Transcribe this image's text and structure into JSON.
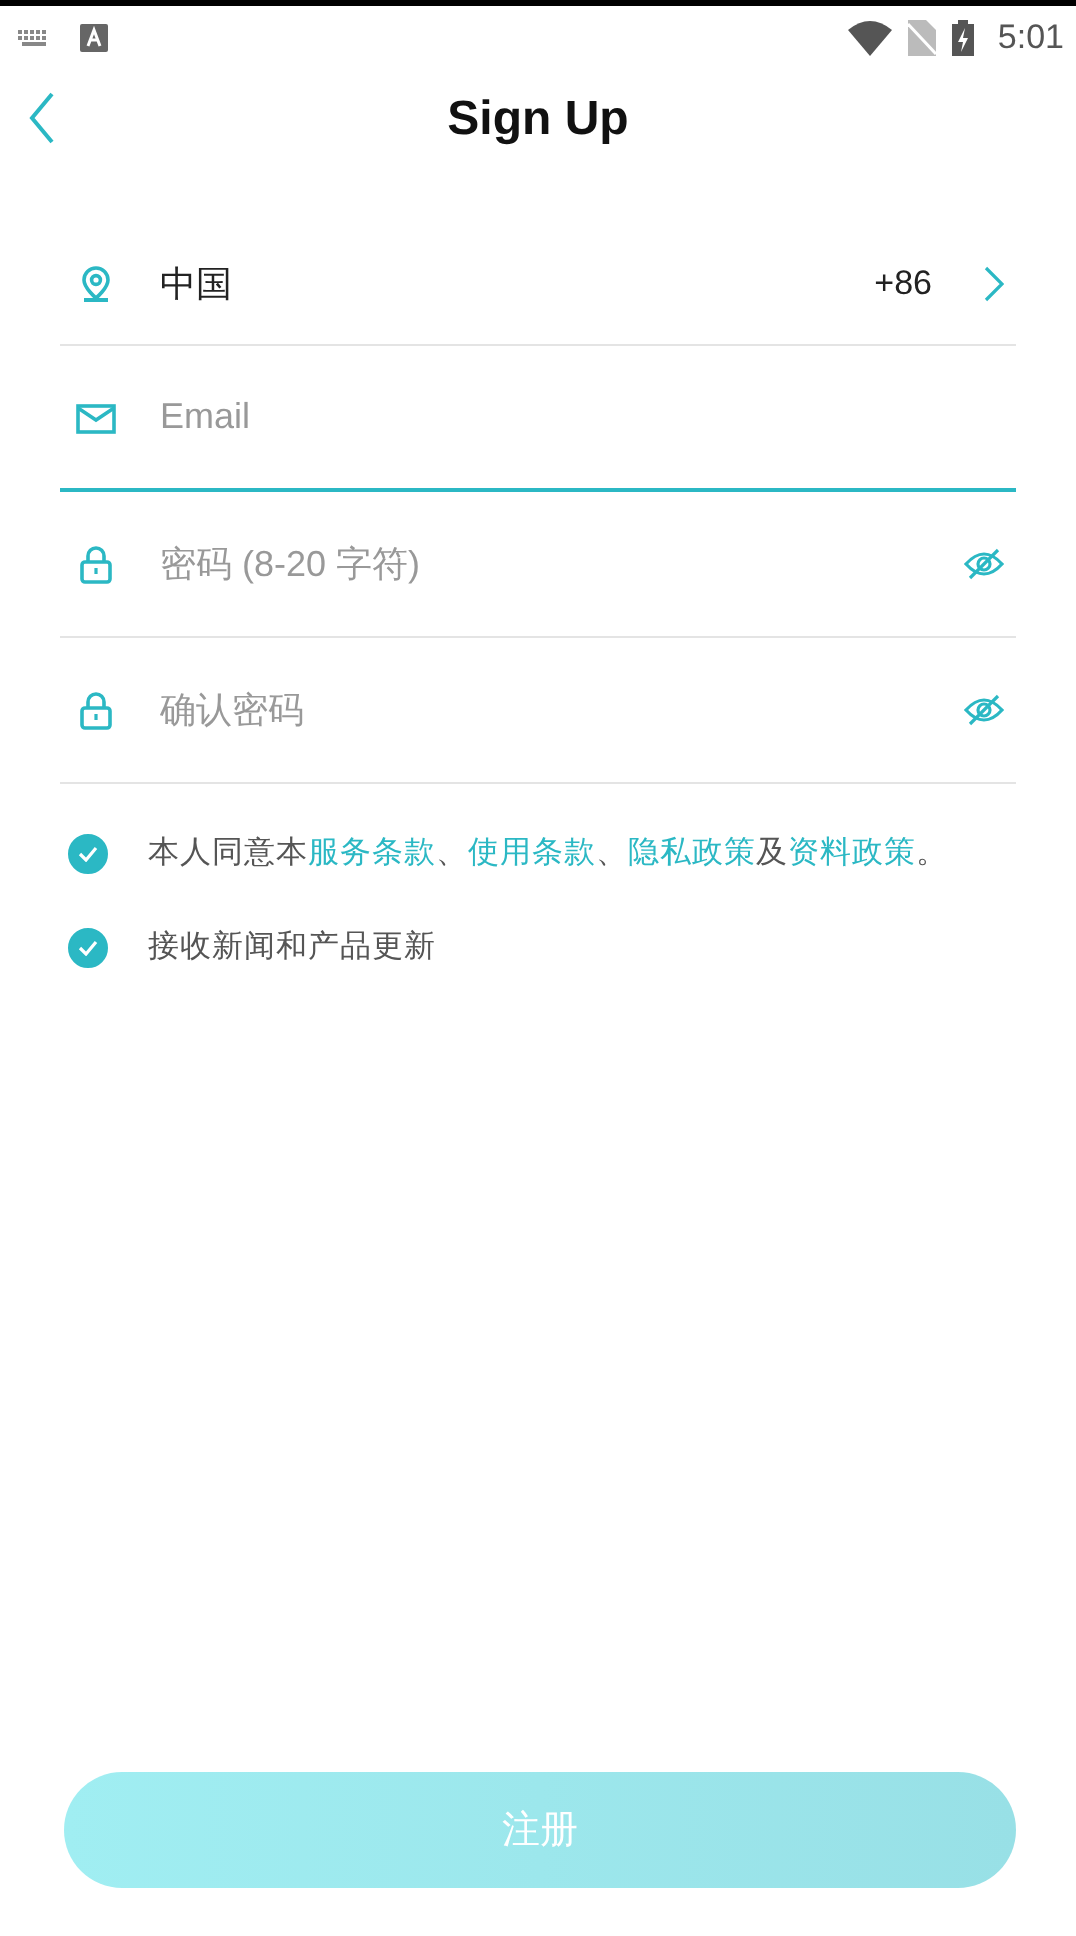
{
  "status_bar": {
    "time": "5:01"
  },
  "header": {
    "title": "Sign Up"
  },
  "fields": [
    {
      "kind": "select",
      "value": "中国",
      "code": "+86",
      "focused": false
    },
    {
      "kind": "email",
      "placeholder": "Email",
      "focused": true
    },
    {
      "kind": "password",
      "placeholder": "密码 (8-20 字符)",
      "focused": false
    },
    {
      "kind": "password",
      "placeholder": "确认密码",
      "focused": false
    }
  ],
  "checks": [
    {
      "checked": true,
      "segments": [
        {
          "kind": "text",
          "text": "本人同意本"
        },
        {
          "kind": "link",
          "text": "服务条款"
        },
        {
          "kind": "text",
          "text": "、"
        },
        {
          "kind": "link",
          "text": "使用条款"
        },
        {
          "kind": "text",
          "text": "、"
        },
        {
          "kind": "link",
          "text": "隐私政策"
        },
        {
          "kind": "text",
          "text": "及"
        },
        {
          "kind": "link",
          "text": "资料政策"
        },
        {
          "kind": "text",
          "text": "。"
        }
      ]
    },
    {
      "checked": true,
      "segments": [
        {
          "kind": "text",
          "text": "接收新闻和产品更新"
        }
      ]
    }
  ],
  "submit": {
    "label": "注册",
    "disabled": true
  }
}
